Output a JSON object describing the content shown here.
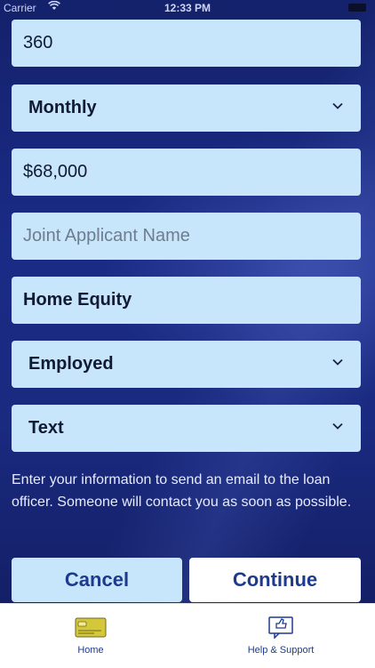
{
  "status_bar": {
    "carrier": "Carrier",
    "time": "12:33 PM"
  },
  "form": {
    "term": "360",
    "frequency": "Monthly",
    "amount": "$68,000",
    "joint_applicant_placeholder": "Joint Applicant Name",
    "loan_purpose": "Home Equity",
    "employment_status": "Employed",
    "contact_method": "Text"
  },
  "info_text": "Enter your information to send an email to the loan officer. Someone will contact you as soon as possible.",
  "buttons": {
    "cancel": "Cancel",
    "continue": "Continue"
  },
  "tabbar": {
    "home": "Home",
    "help": "Help & Support"
  },
  "colors": {
    "background": "#1a2b86",
    "field": "#c8e6fb",
    "accent": "#1d3a8e"
  }
}
